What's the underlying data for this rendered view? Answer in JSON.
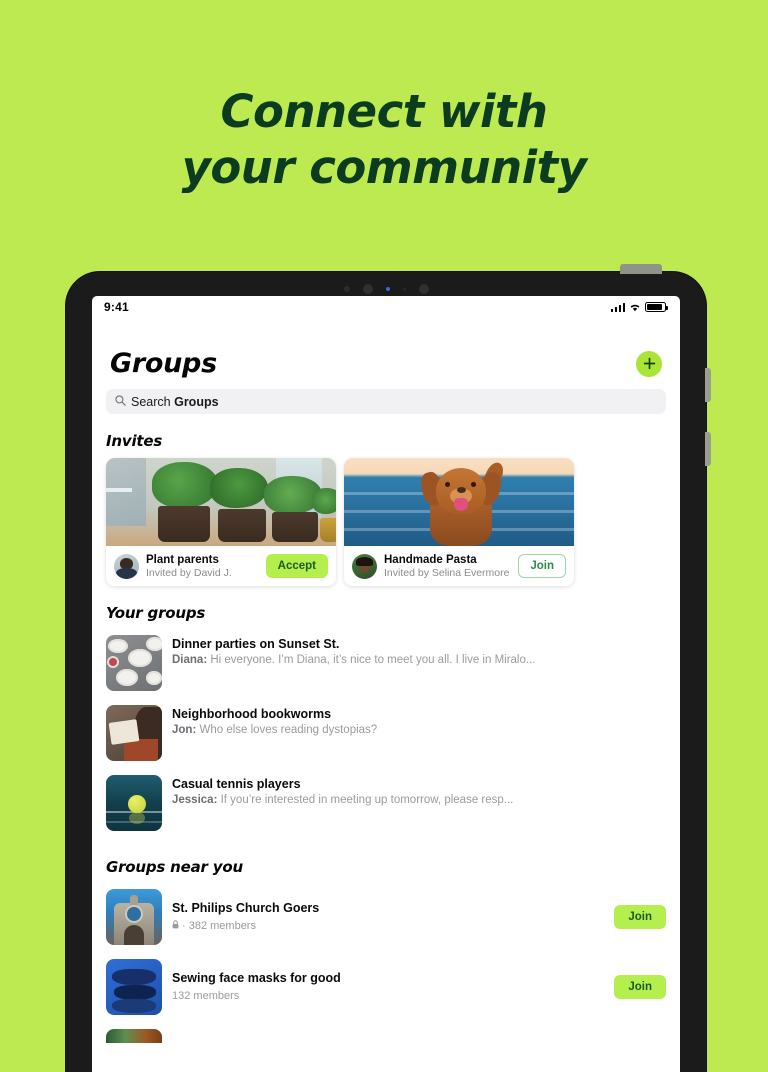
{
  "hero": {
    "line1": "Connect with",
    "line2": "your community",
    "bg_color": "#bdea50",
    "text_color": "#0b3c20"
  },
  "status_bar": {
    "time": "9:41",
    "icons": [
      "cellular-signal-icon",
      "wifi-icon",
      "battery-icon"
    ]
  },
  "header": {
    "title": "Groups",
    "add_button_label": "+",
    "accent_color": "#a9e437"
  },
  "search": {
    "prefix": "Search",
    "scope": "Groups",
    "placeholder": "Search Groups"
  },
  "sections": {
    "invites_title": "Invites",
    "your_groups_title": "Your groups",
    "near_you_title": "Groups near you"
  },
  "invites": [
    {
      "name": "Plant parents",
      "subtitle": "Invited by David J.",
      "action_label": "Accept",
      "action_style": "filled",
      "image": "potted-plants-photo"
    },
    {
      "name": "Handmade Pasta",
      "subtitle": "Invited by Selina Evermore",
      "action_label": "Join",
      "action_style": "outline",
      "image": "dog-in-ocean-photo"
    }
  ],
  "your_groups": [
    {
      "name": "Dinner parties on Sunset St.",
      "sender": "Diana:",
      "message": " Hi everyone. I’m Diana, it’s nice to meet you all. I live in Miralo...",
      "thumb": "dinner-table-photo"
    },
    {
      "name": "Neighborhood bookworms",
      "sender": "Jon:",
      "message": " Who else loves reading dystopias?",
      "thumb": "person-reading-photo"
    },
    {
      "name": "Casual tennis players",
      "sender": "Jessica:",
      "message": " If you’re interested in meeting up tomorrow, please resp...",
      "thumb": "tennis-ball-photo"
    }
  ],
  "near_you": [
    {
      "name": "St. Philips Church Goers",
      "members": "· 382 members",
      "private": true,
      "action_label": "Join",
      "thumb": "church-facade-photo"
    },
    {
      "name": "Sewing face masks for good",
      "members": "132 members",
      "private": false,
      "action_label": "Join",
      "thumb": "face-masks-photo"
    }
  ]
}
